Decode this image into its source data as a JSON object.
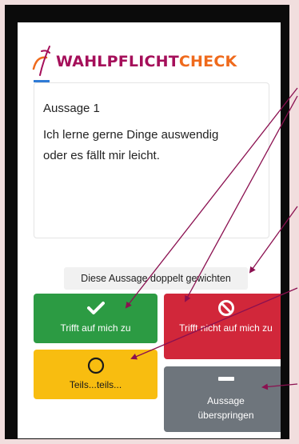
{
  "app": {
    "logo_part1": "WAHLPFLICHT",
    "logo_part2": "CHECK"
  },
  "statement": {
    "title": "Aussage 1",
    "text": "Ich lerne gerne Dinge auswendig oder es fällt mir leicht."
  },
  "progress": {
    "fraction": 0.06
  },
  "weight_button": {
    "label": "Diese Aussage doppelt gewichten"
  },
  "answers": {
    "agree": {
      "label": "Trifft auf mich zu",
      "icon": "check-icon"
    },
    "disagree": {
      "label": "Trifft nicht auf mich zu",
      "icon": "ban-icon"
    },
    "neutral": {
      "label": "Teils...teils...",
      "icon": "circle-icon"
    },
    "skip": {
      "label": "Aussage überspringen",
      "icon": "minus-icon"
    }
  },
  "colors": {
    "brand_purple": "#a50f5a",
    "brand_orange": "#ef6a1c",
    "agree_green": "#2c9b43",
    "disagree_red": "#d1273a",
    "neutral_yellow": "#f8bd10",
    "skip_gray": "#6e757c",
    "annotation_arrow": "#8b1050"
  }
}
